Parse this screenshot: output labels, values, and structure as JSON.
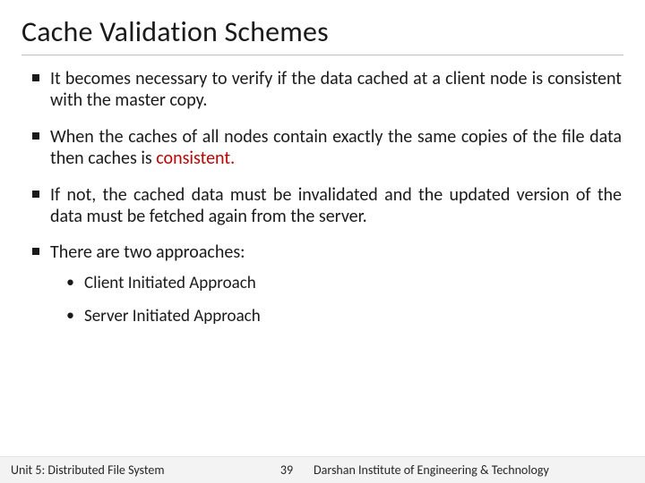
{
  "title": "Cache Validation Schemes",
  "bullets": [
    {
      "pre": "It becomes necessary to verify if the data cached at a client node is consistent with the master copy.",
      "emph": "",
      "post": ""
    },
    {
      "pre": "When the caches of all nodes contain exactly the same copies of the file data then caches is ",
      "emph": "consistent.",
      "post": ""
    },
    {
      "pre": "If not, the cached data must be invalidated and the updated version of the data must be fetched again from the server.",
      "emph": "",
      "post": ""
    },
    {
      "pre": "There are two approaches:",
      "emph": "",
      "post": ""
    }
  ],
  "subbullets": [
    "Client Initiated Approach",
    "Server Initiated Approach"
  ],
  "footer": {
    "unit": "Unit 5: Distributed File System",
    "page": "39",
    "institute": "Darshan Institute of Engineering & Technology"
  }
}
